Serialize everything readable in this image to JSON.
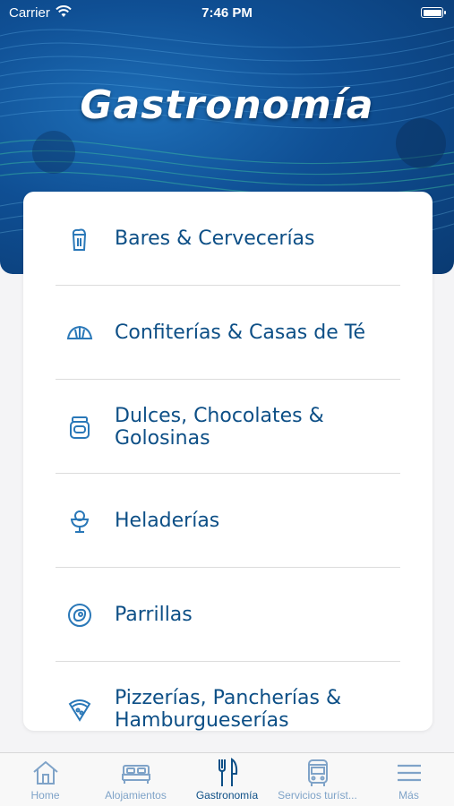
{
  "status_bar": {
    "carrier": "Carrier",
    "time": "7:46 PM"
  },
  "header": {
    "title": "Gastronomía"
  },
  "categories": [
    {
      "label": "Bares & Cervecerías",
      "icon": "beer-mug-icon"
    },
    {
      "label": "Confiterías & Casas de Té",
      "icon": "croissant-icon"
    },
    {
      "label": "Dulces, Chocolates & Golosinas",
      "icon": "jar-icon"
    },
    {
      "label": "Heladerías",
      "icon": "ice-cream-cup-icon"
    },
    {
      "label": "Parrillas",
      "icon": "steak-icon"
    },
    {
      "label": "Pizzerías, Pancherías & Hamburgueserías",
      "icon": "pizza-icon"
    }
  ],
  "tabbar": {
    "items": [
      {
        "label": "Home",
        "icon": "house-icon",
        "active": false
      },
      {
        "label": "Alojamientos",
        "icon": "bed-icon",
        "active": false
      },
      {
        "label": "Gastronomía",
        "icon": "fork-knife-icon",
        "active": true
      },
      {
        "label": "Servicios turíst...",
        "icon": "bus-icon",
        "active": false
      },
      {
        "label": "Más",
        "icon": "menu-icon",
        "active": false
      }
    ]
  },
  "colors": {
    "accent": "#0d4f86",
    "inactive_tab": "#7fa3c8",
    "hero": "#0f4f94"
  }
}
